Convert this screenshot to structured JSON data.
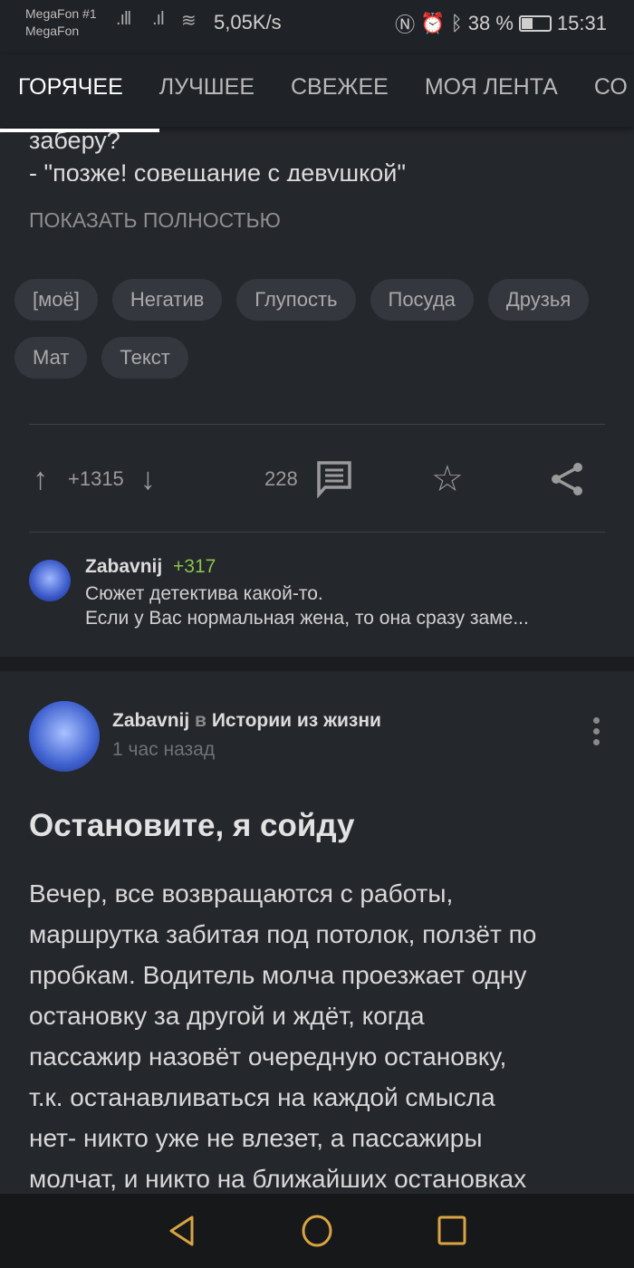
{
  "status_bar": {
    "carrier1": "MegaFon #1",
    "carrier2": "MegaFon",
    "speed": "5,05K/s",
    "battery": "38 %",
    "battery_level": 38,
    "time": "15:31",
    "icons": [
      "signal-icon",
      "signal-icon",
      "wifi-icon",
      "nfc-icon",
      "alarm-icon",
      "bluetooth-icon",
      "battery-icon"
    ]
  },
  "tabs": [
    {
      "label": "ГОРЯЧЕЕ",
      "active": true
    },
    {
      "label": "ЛУЧШЕЕ"
    },
    {
      "label": "СВЕЖЕЕ"
    },
    {
      "label": "МОЯ ЛЕНТА"
    },
    {
      "label": "СО"
    }
  ],
  "prev_post": {
    "text_line": "заберу?",
    "clipped_line": "- \"позже! совещание с девушкой\"",
    "show_full": "ПОКАЗАТЬ ПОЛНОСТЬЮ",
    "tags": [
      "[моё]",
      "Негатив",
      "Глупость",
      "Посуда",
      "Друзья",
      "Мат",
      "Текст"
    ],
    "rating": "+1315",
    "comments": "228",
    "top_comment": {
      "author": "Zabavnij",
      "rating": "+317",
      "line1": "Сюжет детектива какой-то.",
      "line2": "Если у Вас нормальная жена, то она сразу заме..."
    }
  },
  "post": {
    "author": "Zabavnij",
    "in": "в",
    "community": "Истории из жизни",
    "time": "1 час назад",
    "title": "Остановите, я сойду",
    "body": [
      "Вечер, все возвращаются с работы,",
      "маршрутка забитая под потолок, ползёт по",
      "пробкам. Водитель молча проезжает одну",
      "остановку за другой и ждёт, когда",
      "пассажир назовёт очередную остановку,",
      "т.к. останавливаться на каждой смысла",
      "нет- никто уже не влезет, а пассажиры",
      "молчат, и никто на ближайших остановках"
    ]
  },
  "colors": {
    "background": "#24272c",
    "accent_rating": "#8bc34a",
    "nav_icons": "#d9a441"
  }
}
